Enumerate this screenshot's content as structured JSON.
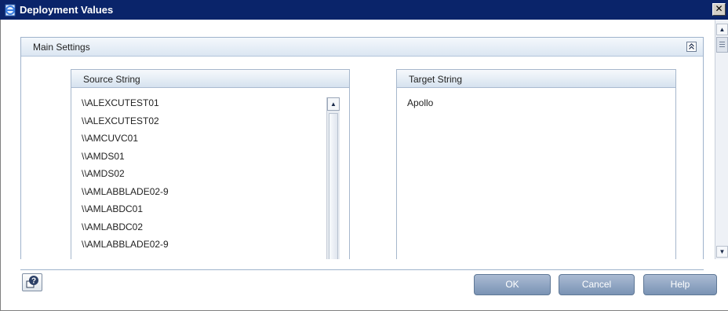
{
  "window": {
    "title": "Deployment Values",
    "close_glyph": "✕"
  },
  "main_panel": {
    "header": "Main Settings",
    "collapse_glyph": "⌃"
  },
  "source": {
    "header": "Source String",
    "items": [
      "\\\\ALEXCUTEST01",
      "\\\\ALEXCUTEST02",
      "\\\\AMCUVC01",
      "\\\\AMDS01",
      "\\\\AMDS02",
      "\\\\AMLABBLADE02-9",
      "\\\\AMLABDC01",
      "\\\\AMLABDC02",
      "\\\\AMLABBLADE02-9"
    ]
  },
  "target": {
    "header": "Target String",
    "value": "Apollo"
  },
  "buttons": {
    "ok": "OK",
    "cancel": "Cancel",
    "help": "Help"
  },
  "icons": {
    "title": "ie-document-icon",
    "help_icon": "context-help-icon"
  }
}
